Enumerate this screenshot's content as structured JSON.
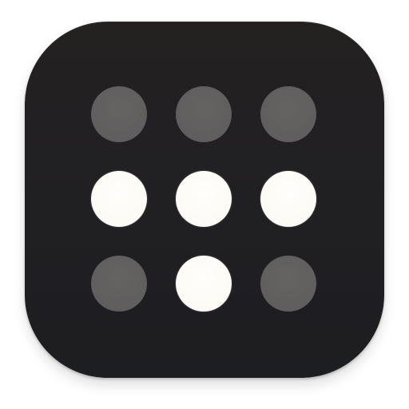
{
  "icon": {
    "name": "dot-grid-app-icon",
    "background_color": "#221f21",
    "lit_dot_color": "#fcfaf4",
    "unlit_dot_color": "#626060"
  },
  "grid": {
    "rows": 3,
    "columns": 3,
    "states": [
      [
        "off",
        "off",
        "off"
      ],
      [
        "on",
        "on",
        "on"
      ],
      [
        "off",
        "on",
        "off"
      ]
    ]
  }
}
